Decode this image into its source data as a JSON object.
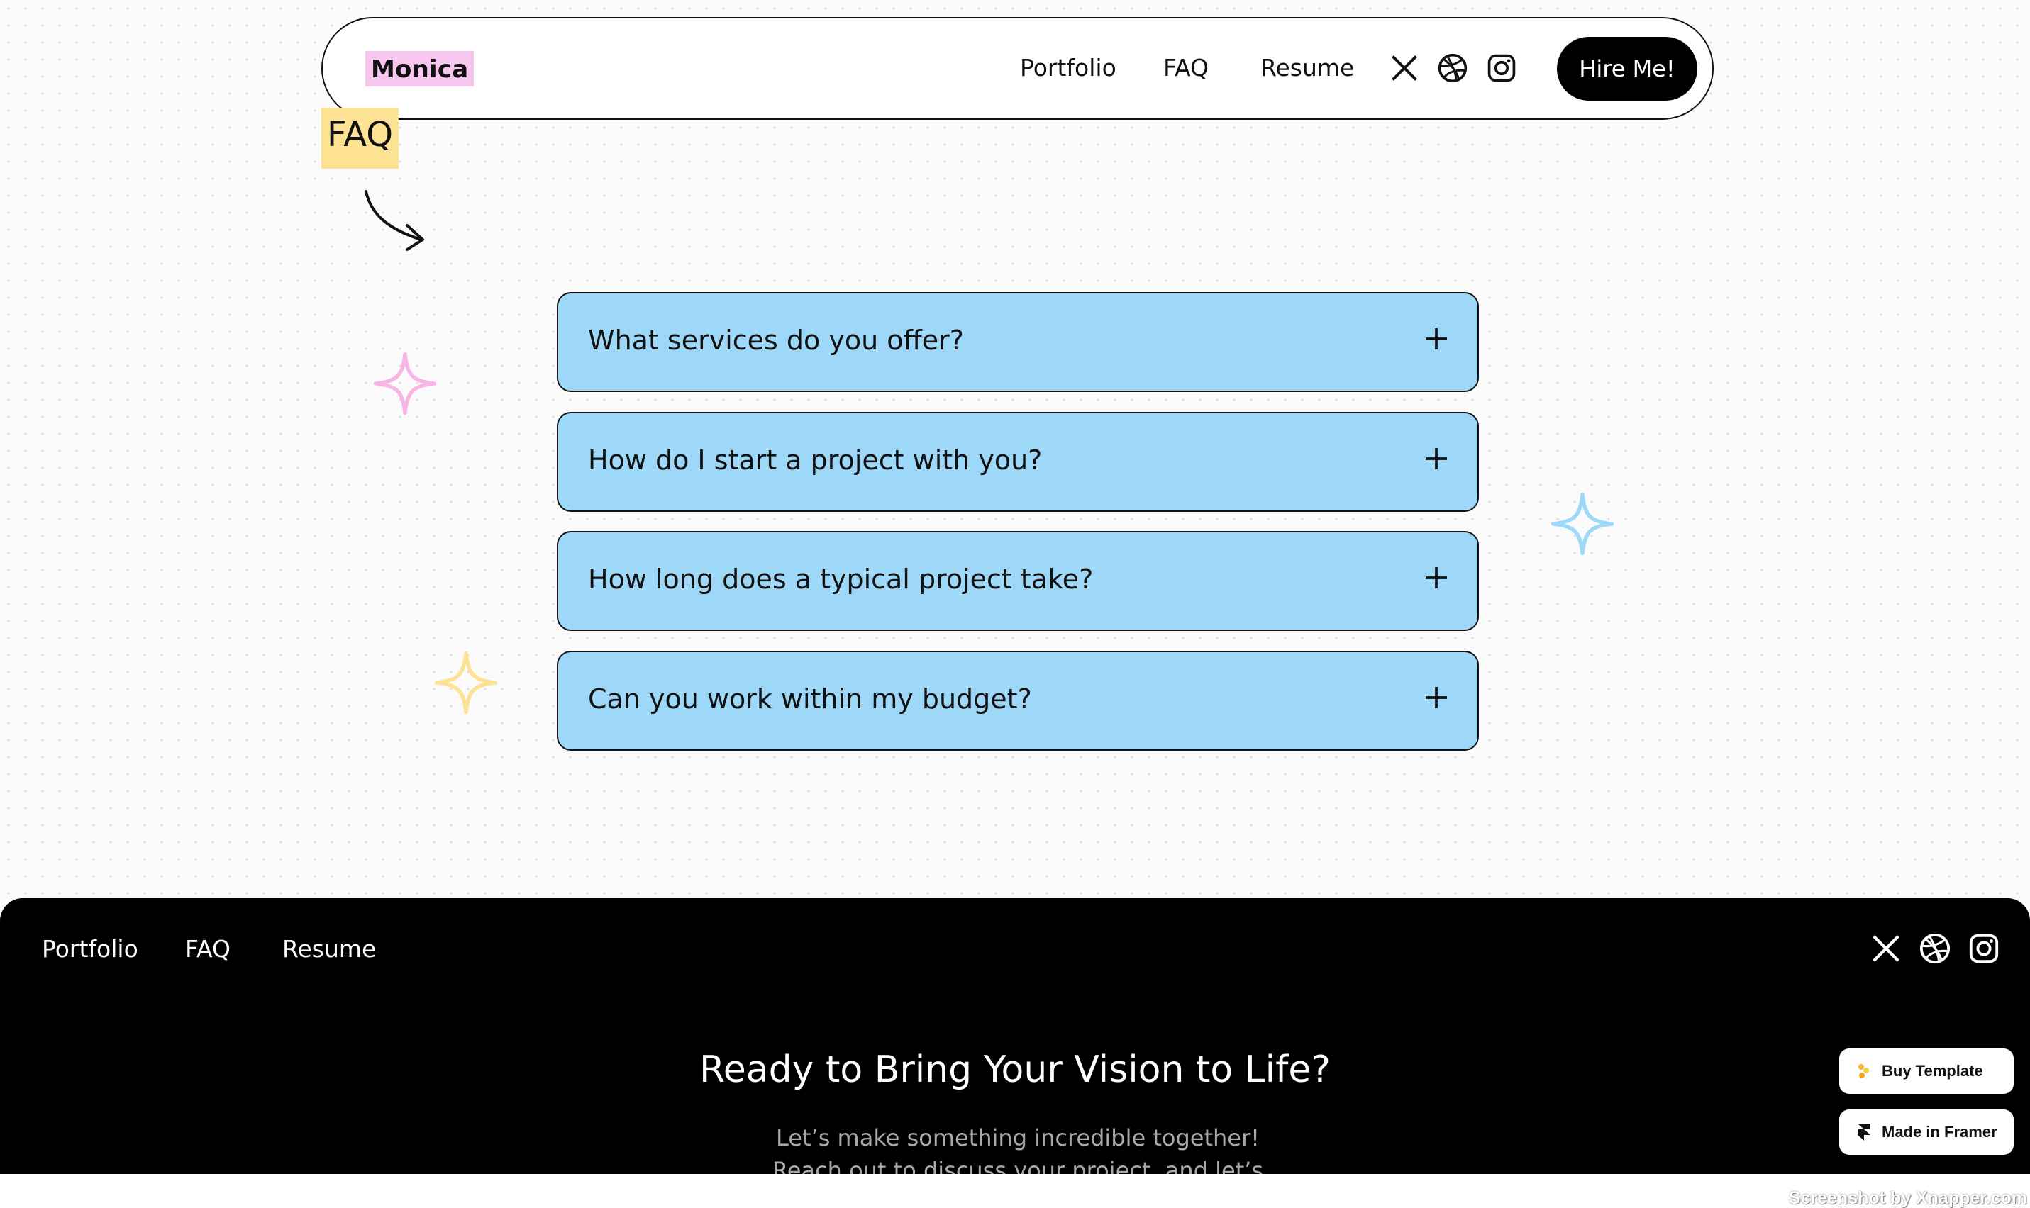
{
  "header": {
    "logo": "Monica",
    "nav": [
      "Portfolio",
      "FAQ",
      "Resume"
    ],
    "social_icons": [
      "x-icon",
      "dribbble-icon",
      "instagram-icon"
    ],
    "cta": "Hire Me!"
  },
  "section": {
    "tag": "FAQ"
  },
  "faq": [
    {
      "question": "What services do you offer?"
    },
    {
      "question": "How do I start a project with you?"
    },
    {
      "question": "How long does a typical project take?"
    },
    {
      "question": "Can you work within my budget?"
    }
  ],
  "footer": {
    "nav": [
      "Portfolio",
      "FAQ",
      "Resume"
    ],
    "social_icons": [
      "x-icon",
      "dribbble-icon",
      "instagram-icon"
    ],
    "cta_title": "Ready to Bring Your Vision to Life?",
    "cta_text": "Let’s make something incredible together! Reach out to discuss your project, and let’s create"
  },
  "badges": {
    "buy": "Buy Template",
    "made": "Made in Framer"
  },
  "watermark": "Screenshot by Xnapper.com",
  "colors": {
    "faq_bg": "#9ed8f9",
    "logo_bg": "#f7c6ee",
    "tag_bg": "#fde293",
    "sparkle_pink": "#f7b6e6",
    "sparkle_blue": "#9ed8f9",
    "sparkle_yellow": "#fde293"
  }
}
